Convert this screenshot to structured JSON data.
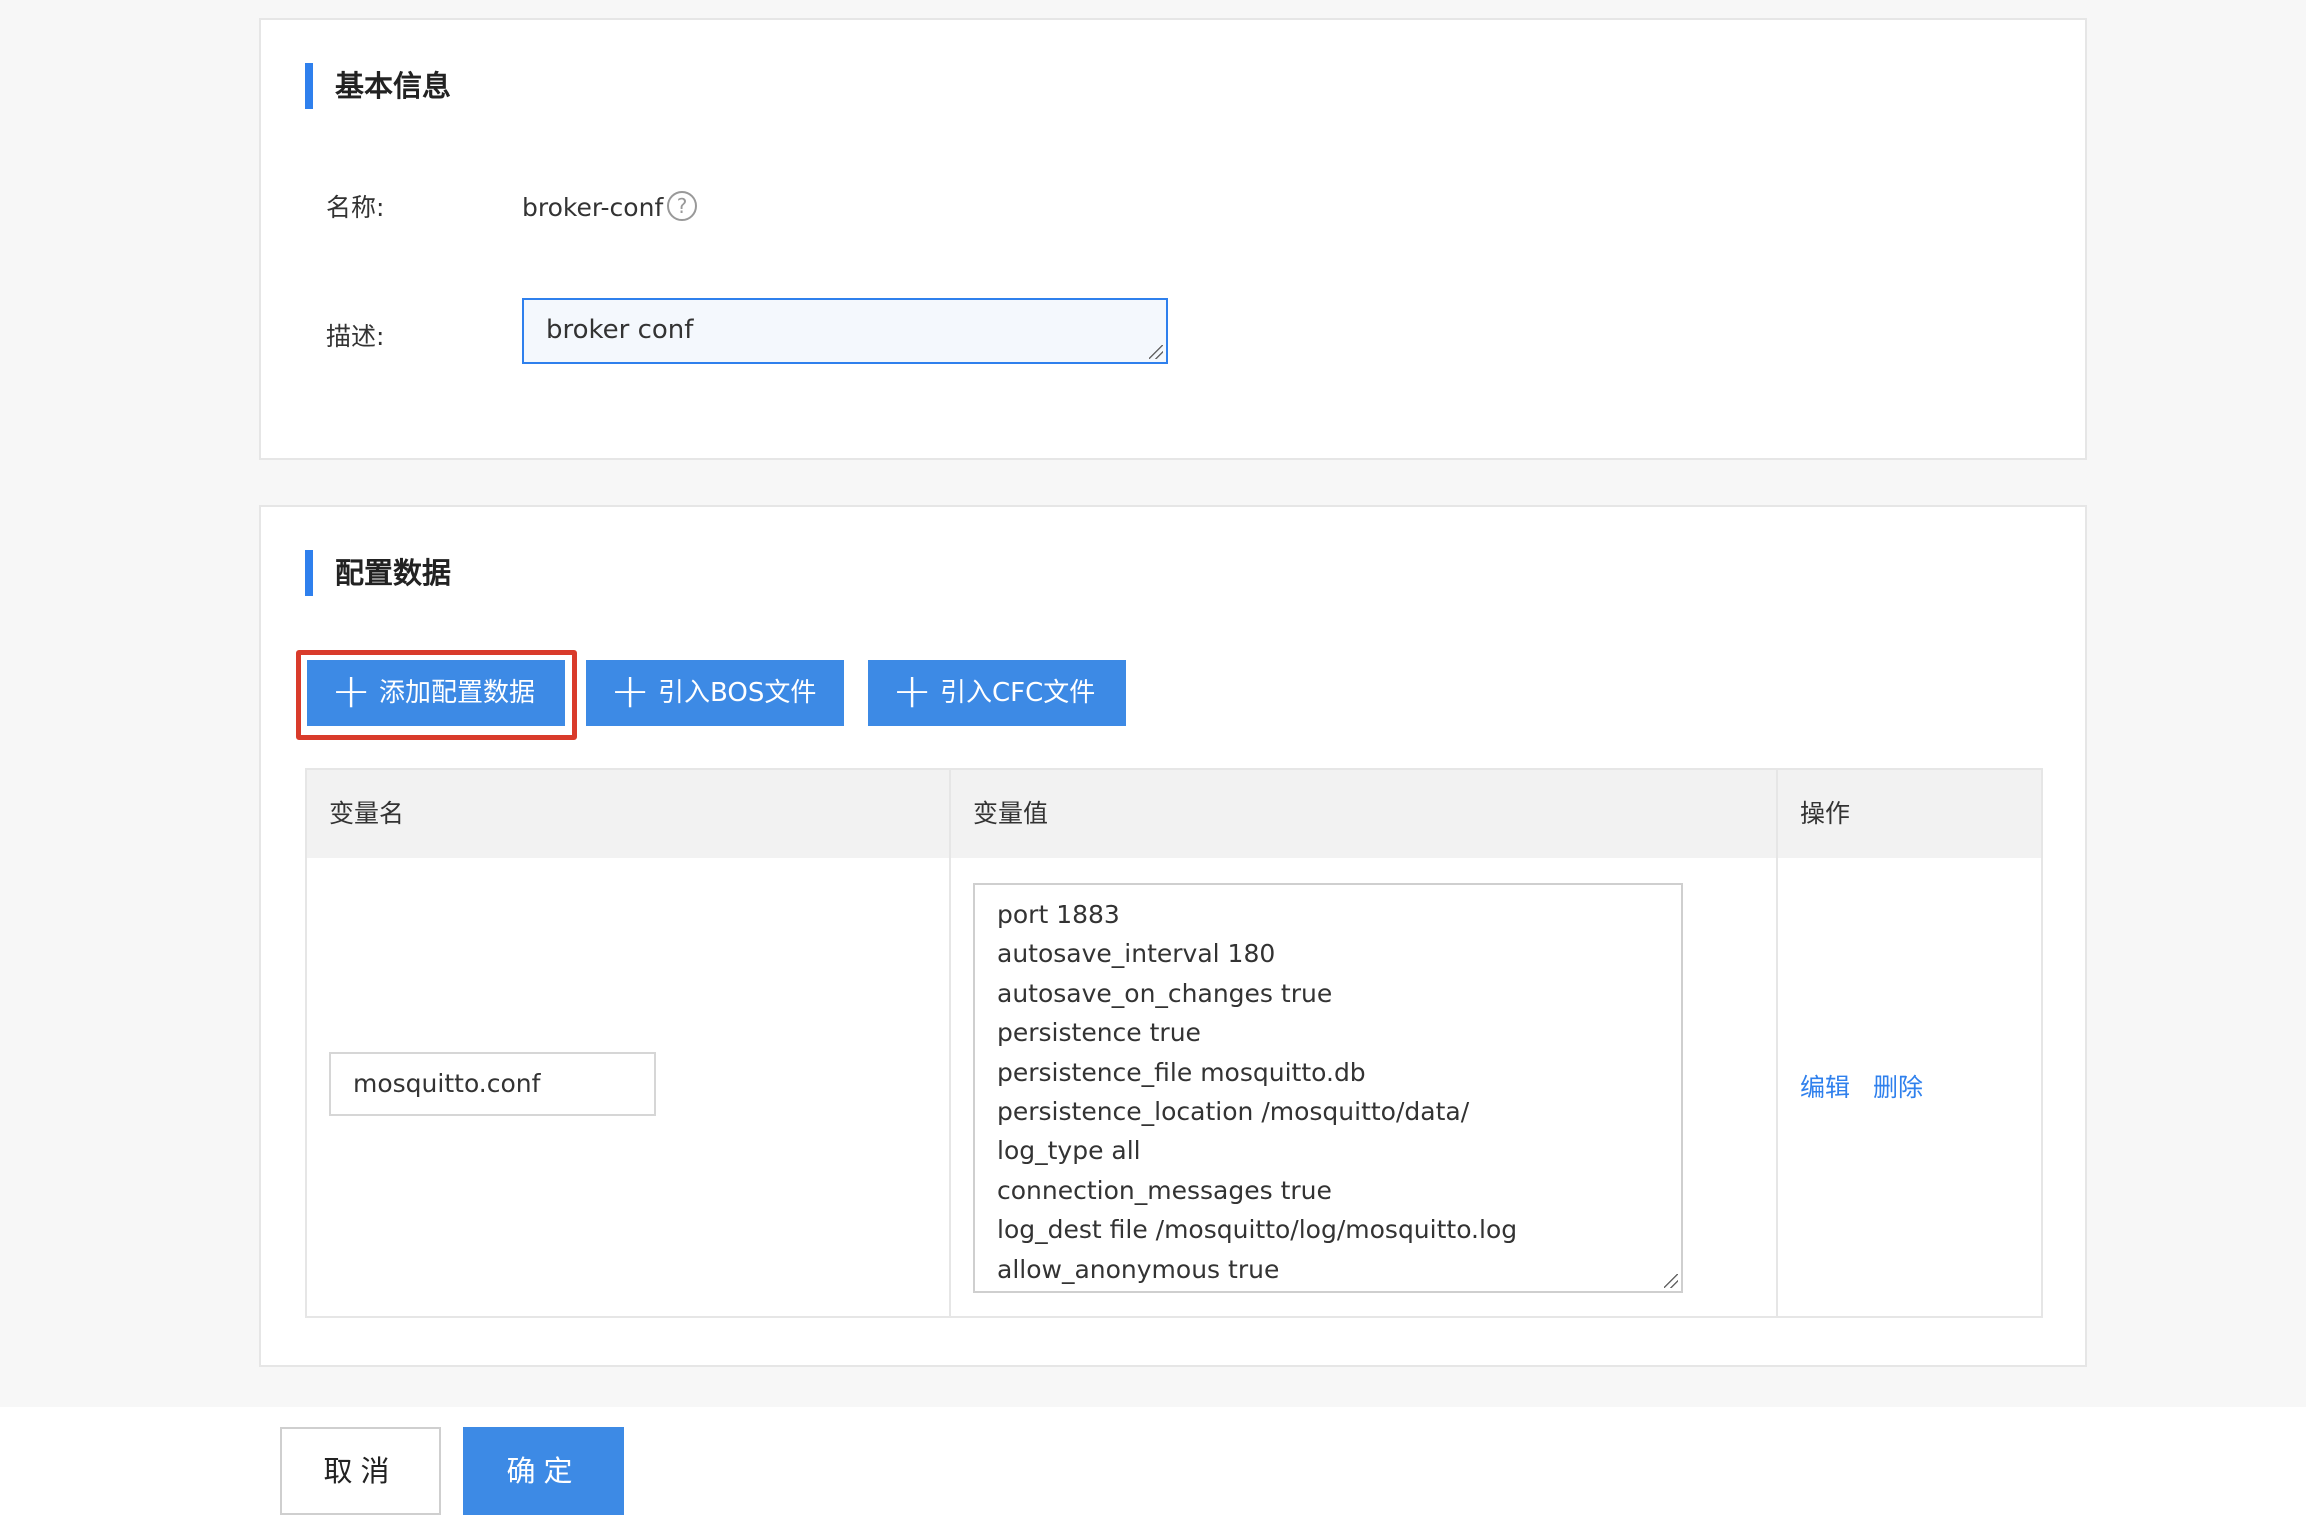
{
  "basic_section": {
    "title": "基本信息",
    "name_label": "名称:",
    "name_value": "broker-conf",
    "help_icon_glyph": "?",
    "desc_label": "描述:",
    "desc_value": "broker conf"
  },
  "config_section": {
    "title": "配置数据",
    "buttons": {
      "add_config": "添加配置数据",
      "import_bos": "引入BOS文件",
      "import_cfc": "引入CFC文件",
      "plus_glyph": "+"
    },
    "table": {
      "headers": {
        "var_name": "变量名",
        "var_value": "变量值",
        "actions": "操作"
      },
      "rows": [
        {
          "name": "mosquitto.conf",
          "value_lines": [
            "port 1883",
            "autosave_interval 180",
            "autosave_on_changes true",
            "persistence true",
            "persistence_file mosquitto.db",
            "persistence_location /mosquitto/data/",
            "log_type all",
            "connection_messages true",
            "log_dest file /mosquitto/log/mosquitto.log",
            "allow_anonymous true"
          ],
          "edit_label": "编辑",
          "delete_label": "删除"
        }
      ]
    }
  },
  "footer": {
    "cancel_label": "取消",
    "confirm_label": "确定"
  },
  "colors": {
    "accent": "#3d8ae5",
    "highlight_border": "#d93b2b"
  }
}
